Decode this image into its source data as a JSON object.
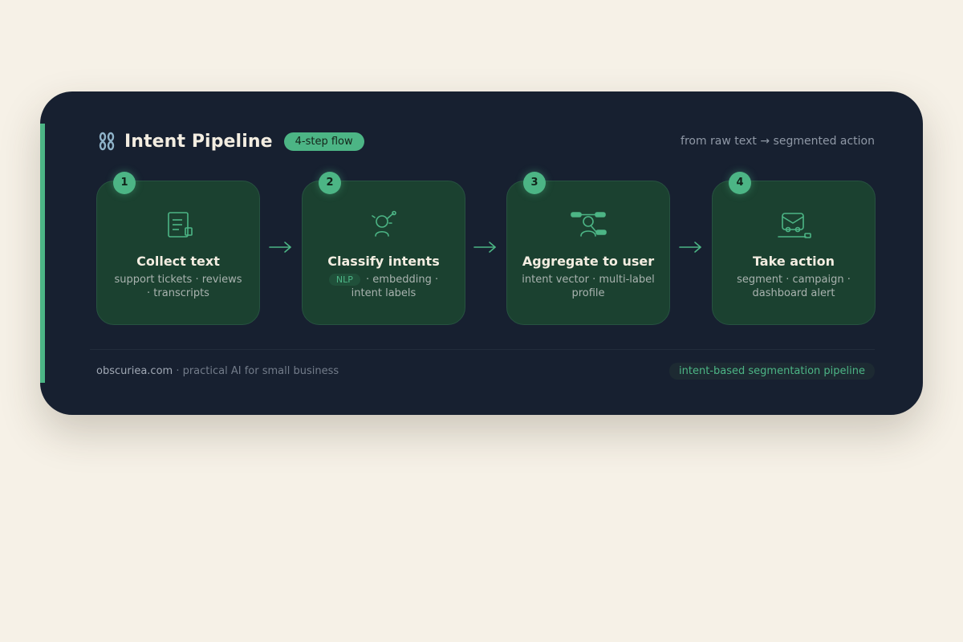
{
  "header": {
    "title": "Intent Pipeline",
    "pill": "4-step flow",
    "subtitle": "from raw text → segmented action",
    "icon": "chain-link-icon"
  },
  "steps": [
    {
      "number": "1",
      "title": "Collect text",
      "description": "support tickets · reviews · transcripts",
      "icon": "document-icon"
    },
    {
      "number": "2",
      "title": "Classify intents",
      "tag": "NLP",
      "description": " · embedding · intent labels",
      "icon": "classifier-icon"
    },
    {
      "number": "3",
      "title": "Aggregate to user",
      "description": "intent vector · multi-label profile",
      "icon": "user-aggregate-icon"
    },
    {
      "number": "4",
      "title": "Take action",
      "description": "segment · campaign · dashboard alert",
      "icon": "mail-action-icon"
    }
  ],
  "footer": {
    "brand": "obscuriea.com",
    "tagline": " · practical AI for small business",
    "pill": "intent-based segmentation pipeline"
  },
  "colors": {
    "accent": "#4cb585",
    "card_bg": "#172030",
    "step_bg": "#1b4130",
    "page_bg": "#f6f1e7"
  }
}
